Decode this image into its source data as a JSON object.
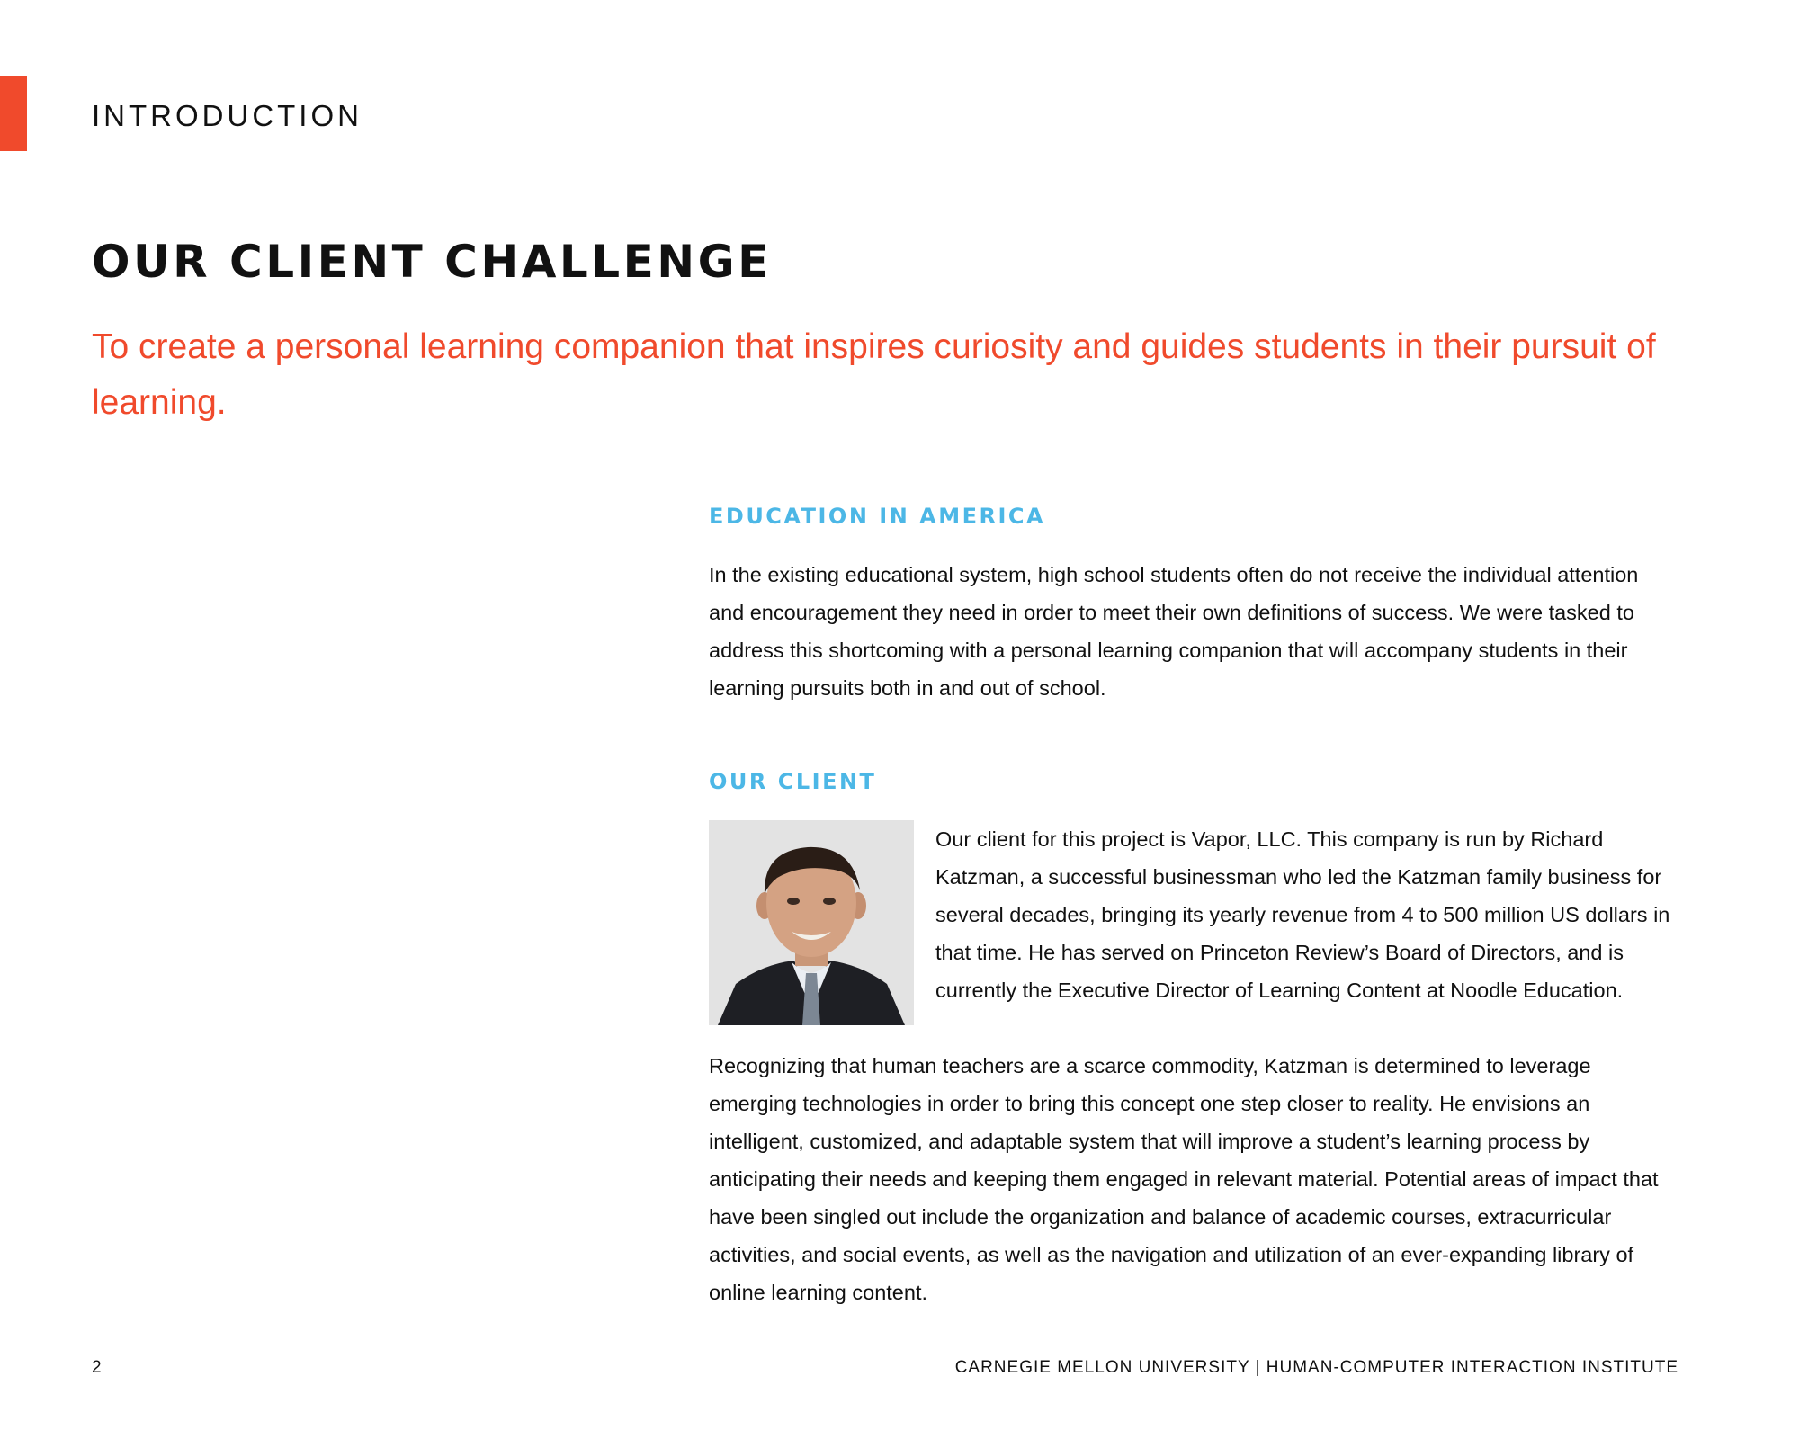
{
  "header": {
    "section_label": "INTRODUCTION",
    "accent_color": "#f04a2c"
  },
  "title": "OUR CLIENT CHALLENGE",
  "mission": "To create a personal learning companion that inspires curiosity and guides students in their pursuit of learning.",
  "education": {
    "heading": "EDUCATION IN AMERICA",
    "body": "In the existing educational system, high school students often do not receive the individual attention and encouragement they need in order to meet their own definitions of success. We were tasked to address this shortcoming with a personal learning companion that will accompany students in their learning pursuits both in and out of school."
  },
  "client": {
    "heading": "OUR CLIENT",
    "photo_icon": "client-portrait",
    "intro": "Our client for this project is Vapor, LLC. This company is run by Richard Katzman, a successful businessman who led the Katzman family business for several decades, bringing its yearly revenue from 4 to 500 million US dollars in that time. He has served on Princeton Review’s Board of Directors, and is currently the Executive Director of Learning Content at Noodle Education.",
    "body": "Recognizing that human teachers are a scarce commodity, Katzman is determined to leverage emerging technologies in order to bring this concept one step closer to reality. He envisions an intelligent, customized, and adaptable system that will improve a student’s learning process by anticipating their needs and keeping them engaged in relevant material. Potential areas of impact that have been singled out include the organization and balance of academic courses, extracurricular activities, and social events, as well as the navigation and utilization of an ever-expanding library of online learning content."
  },
  "footer": {
    "page_number": "2",
    "text": "CARNEGIE MELLON UNIVERSITY | HUMAN-COMPUTER INTERACTION INSTITUTE"
  },
  "colors": {
    "accent": "#f04a2c",
    "subhead": "#4cb7e6",
    "text": "#111111"
  }
}
